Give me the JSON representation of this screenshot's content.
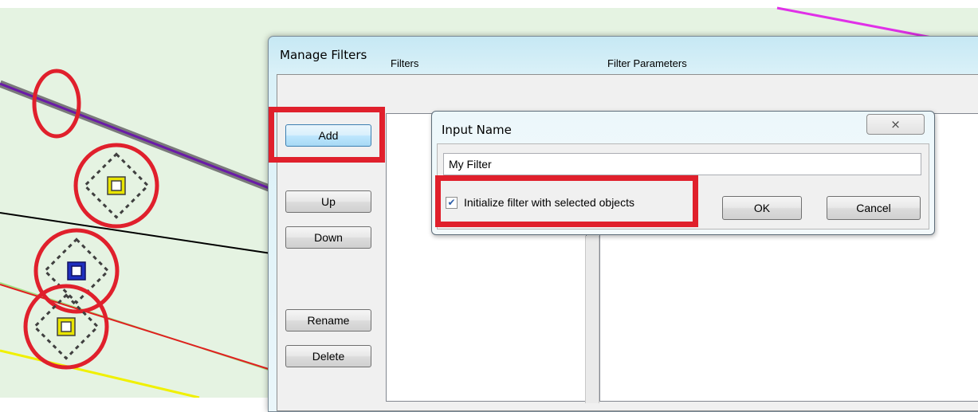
{
  "manage_filters": {
    "title": "Manage Filters",
    "filters_header": "Filters",
    "params_header": "Filter Parameters",
    "buttons": {
      "add": "Add",
      "up": "Up",
      "down": "Down",
      "rename": "Rename",
      "delete": "Delete"
    }
  },
  "input_dialog": {
    "title": "Input Name",
    "close_glyph": "⨯",
    "name_value": "My Filter",
    "checkbox_label": "Initialize filter with selected objects",
    "checkbox_checked": true,
    "ok": "OK",
    "cancel": "Cancel"
  },
  "colors": {
    "canvas_bg": "#e5f3e2",
    "highlight": "#e0202c",
    "selected_node": "#1f2fbf",
    "node": "#e8e400"
  },
  "icons": {
    "close": "close-icon",
    "check": "check-icon"
  }
}
